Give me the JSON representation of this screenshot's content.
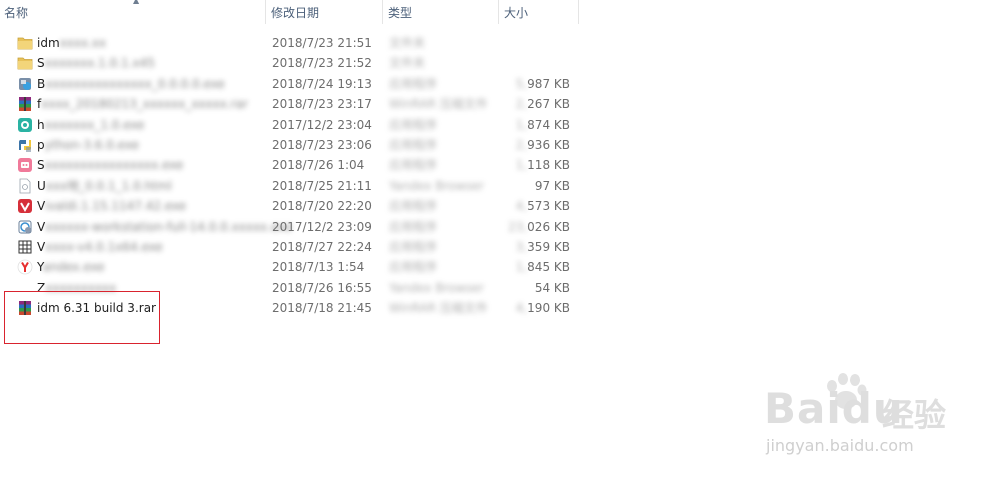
{
  "columns": {
    "name": "名称",
    "date": "修改日期",
    "type": "类型",
    "size": "大小"
  },
  "files": [
    {
      "name": "idm",
      "date": "2018/7/23 21:51",
      "type": "",
      "size": "",
      "icon": "folder-icon"
    },
    {
      "name": "S",
      "date": "2018/7/23 21:52",
      "type": "",
      "size": "",
      "icon": "folder-icon"
    },
    {
      "name": "B",
      "date": "2018/7/24 19:13",
      "type": "",
      "size": "987 KB",
      "icon": "installer-icon"
    },
    {
      "name": "f",
      "date": "2018/7/23 23:17",
      "type": "",
      "size": "267 KB",
      "icon": "rar-archive-icon"
    },
    {
      "name": "h",
      "date": "2017/12/2 23:04",
      "type": "",
      "size": "874 KB",
      "icon": "app-icon"
    },
    {
      "name": "p",
      "date": "2018/7/23 23:06",
      "type": "",
      "size": "936 KB",
      "icon": "python-icon"
    },
    {
      "name": "S",
      "date": "2018/7/26 1:04",
      "type": "",
      "size": "118 KB",
      "icon": "app-icon"
    },
    {
      "name": "U",
      "date": "2018/7/25 21:11",
      "type": "",
      "size": "97 KB",
      "icon": "document-icon"
    },
    {
      "name": "V",
      "date": "2018/7/20 22:20",
      "type": "",
      "size": "573 KB",
      "icon": "vivaldi-icon"
    },
    {
      "name": "V",
      "date": "2017/12/2 23:09",
      "type": "",
      "size": "026 KB",
      "icon": "vmware-icon"
    },
    {
      "name": "V",
      "date": "2018/7/27 22:24",
      "type": "",
      "size": "359 KB",
      "icon": "grid-app-icon"
    },
    {
      "name": "Y",
      "date": "2018/7/13 1:54",
      "type": "",
      "size": "845 KB",
      "icon": "yandex-icon"
    },
    {
      "name": "Z",
      "date": "2018/7/26 16:55",
      "type": "",
      "size": "54 KB",
      "icon": "blank-file-icon"
    },
    {
      "name": "idm 6.31 build 3.rar",
      "date": "2018/7/18 21:45",
      "type": "",
      "size": "190 KB",
      "icon": "rar-archive-icon"
    }
  ],
  "watermark": {
    "main": "Bai",
    "cn": "经验",
    "sub": "jingyan.baidu.com"
  },
  "colors": {
    "highlight": "#d9232e",
    "folder": "#e8c25a"
  }
}
